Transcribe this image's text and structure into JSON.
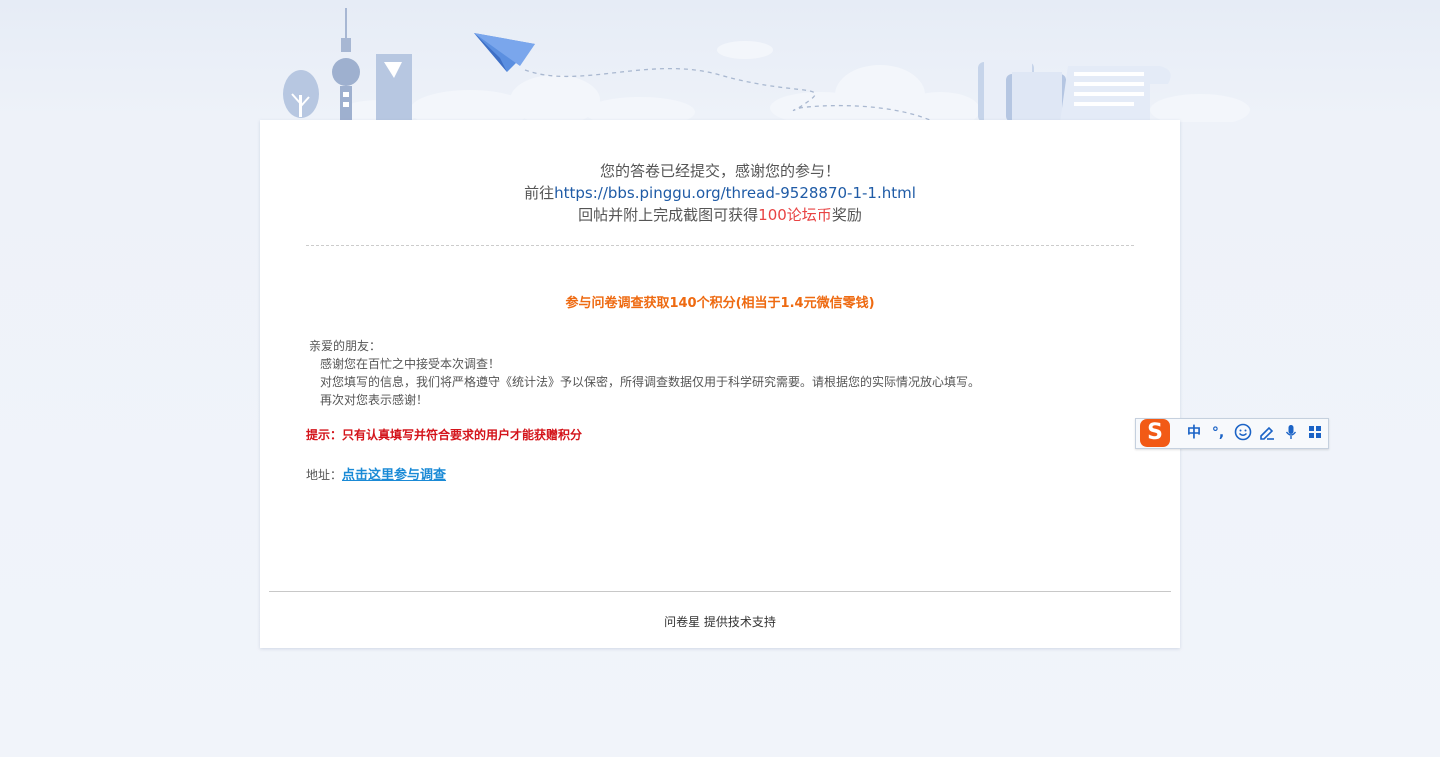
{
  "message": {
    "line1": "您的答卷已经提交，感谢您的参与！",
    "line2_prefix": "前往",
    "line2_link": "https://bbs.pinggu.org/thread-9528870-1-1.html",
    "line3_prefix": "回帖并附上完成截图可获得",
    "line3_highlight": "100论坛币",
    "line3_suffix": "奖励"
  },
  "survey_title": "参与问卷调查获取140个积分(相当于1.4元微信零钱)",
  "letter": {
    "greeting": "亲爱的朋友：",
    "p1": "感谢您在百忙之中接受本次调查！",
    "p2": "对您填写的信息，我们将严格遵守《统计法》予以保密，所得调查数据仅用于科学研究需要。请根据您的实际情况放心填写。",
    "p3": "再次对您表示感谢！"
  },
  "tip": "提示：只有认真填写并符合要求的用户才能获赠积分",
  "address": {
    "label": "地址：",
    "link_text": "点击这里参与调查"
  },
  "footer": {
    "brand": "问卷星",
    "text": "提供技术支持"
  },
  "ime_toolbar": {
    "logo": "S",
    "lang": "中",
    "punct": "°,",
    "icons": [
      "smiley-icon",
      "pen-icon",
      "microphone-icon",
      "grid-icon"
    ]
  },
  "colors": {
    "link": "#1f5ba6",
    "highlight_red": "#e84343",
    "survey_orange": "#ee6a11",
    "tip_red": "#d4141b",
    "address_link": "#1a8ad6",
    "ime_logo": "#f25a16"
  }
}
